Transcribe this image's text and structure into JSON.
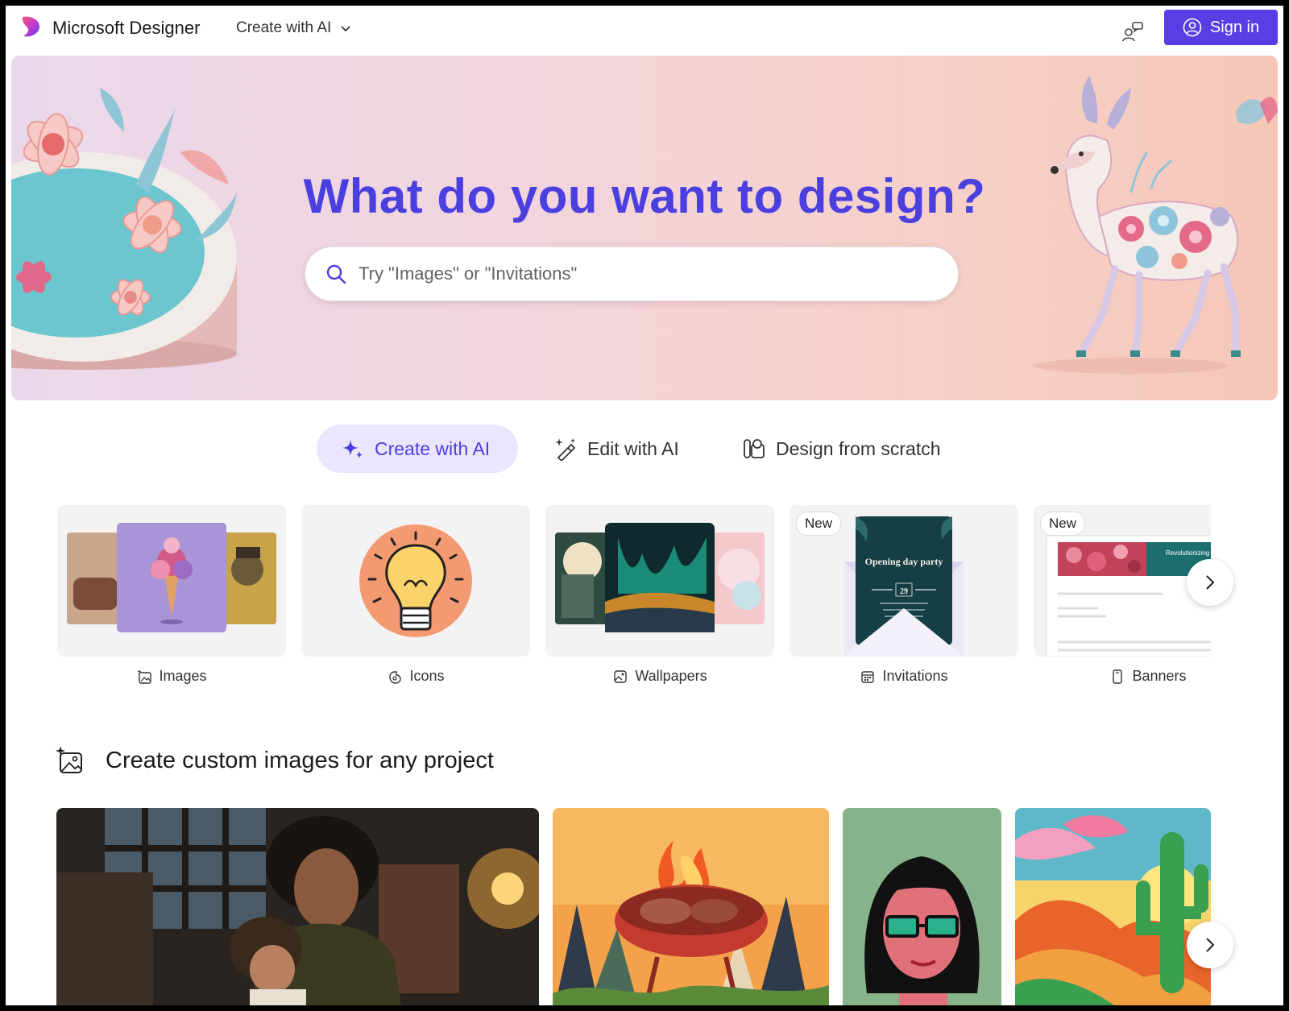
{
  "header": {
    "brand": "Microsoft Designer",
    "create_menu_label": "Create with AI",
    "signin_label": "Sign in"
  },
  "hero": {
    "title": "What do you want to design?",
    "search_placeholder": "Try \"Images\" or \"Invitations\""
  },
  "tabs": [
    {
      "label": "Create with AI",
      "icon": "sparkle-icon",
      "active": true
    },
    {
      "label": "Edit with AI",
      "icon": "magic-wand-icon",
      "active": false
    },
    {
      "label": "Design from scratch",
      "icon": "shapes-icon",
      "active": false
    }
  ],
  "categories": [
    {
      "label": "Images",
      "icon": "image-sparkle-icon",
      "badge": ""
    },
    {
      "label": "Icons",
      "icon": "icon-sparkle-icon",
      "badge": ""
    },
    {
      "label": "Wallpapers",
      "icon": "wallpaper-icon",
      "badge": ""
    },
    {
      "label": "Invitations",
      "icon": "calendar-icon",
      "badge": "New"
    },
    {
      "label": "Banners",
      "icon": "phone-icon",
      "badge": "New"
    }
  ],
  "invitation_card": {
    "title": "Opening day party",
    "date": "29"
  },
  "banner_card": {
    "text": "Revolutionizing Mobility: A Smart City"
  },
  "section": {
    "title": "Create custom images for any project",
    "icon": "image-sparkle-icon"
  },
  "colors": {
    "accent": "#4c3fe0",
    "signin_bg": "#5b3ee3",
    "active_tab_bg": "#ebe6fd"
  }
}
